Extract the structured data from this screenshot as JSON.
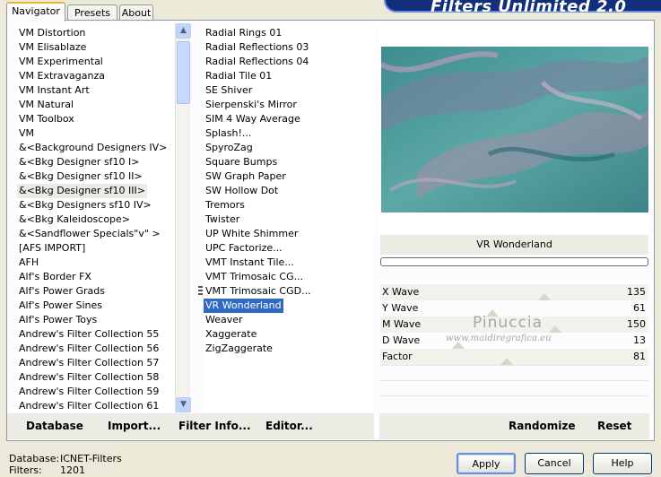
{
  "banner": "Filters Unlimited 2.0",
  "tabs": [
    "Navigator",
    "Presets",
    "About"
  ],
  "categories": [
    "VM Distortion",
    "VM Elisablaze",
    "VM Experimental",
    "VM Extravaganza",
    "VM Instant Art",
    "VM Natural",
    "VM Toolbox",
    "VM",
    "&<Background Designers IV>",
    "&<Bkg Designer sf10 I>",
    "&<Bkg Designer sf10 II>",
    "&<Bkg Designer sf10 III>",
    "&<Bkg Designers sf10 IV>",
    "&<Bkg Kaleidoscope>",
    "&<Sandflower Specials\"v\" >",
    "[AFS IMPORT]",
    "AFH",
    "Alf's Border FX",
    "Alf's Power Grads",
    "Alf's Power Sines",
    "Alf's Power Toys",
    "Andrew's Filter Collection 55",
    "Andrew's Filter Collection 56",
    "Andrew's Filter Collection 57",
    "Andrew's Filter Collection 58",
    "Andrew's Filter Collection 59",
    "Andrew's Filter Collection 61"
  ],
  "selected_category_index": 11,
  "filters": [
    "Radial  Rings 01",
    "Radial Reflections 03",
    "Radial Reflections 04",
    "Radial Tile 01",
    "SE Shiver",
    "Sierpenski's Mirror",
    "SIM 4 Way Average",
    "Splash!...",
    "SpyroZag",
    "Square Bumps",
    "SW Graph Paper",
    "SW Hollow Dot",
    "Tremors",
    "Twister",
    "UP White Shimmer",
    "UPC Factorize...",
    "VMT Instant Tile...",
    "VMT Trimosaic CG...",
    "VMT Trimosaic CGD...",
    "VR Wonderland",
    "Weaver",
    "Xaggerate",
    "ZigZaggerate"
  ],
  "selected_filter_index": 19,
  "left_buttons": [
    "Database",
    "Import...",
    "Filter Info...",
    "Editor..."
  ],
  "filter_name": "VR Wonderland",
  "params": [
    {
      "label": "X Wave",
      "value": "135"
    },
    {
      "label": "Y Wave",
      "value": "61"
    },
    {
      "label": "M Wave",
      "value": "150"
    },
    {
      "label": "D Wave",
      "value": "13"
    },
    {
      "label": "Factor",
      "value": "81"
    }
  ],
  "watermark": {
    "line1": "Pinuccia",
    "line2": "www.maidiregrafica.eu"
  },
  "right_buttons": [
    "Randomize",
    "Reset"
  ],
  "footer": {
    "database_label": "Database:",
    "database_value": "ICNET-Filters",
    "filters_label": "Filters:",
    "filters_value": "1201"
  },
  "dialog_buttons": [
    "Apply",
    "Cancel",
    "Help"
  ],
  "colors": {
    "selection": "#316ac5",
    "preview_base": "#4f9a9c",
    "banner": "#12307a"
  }
}
